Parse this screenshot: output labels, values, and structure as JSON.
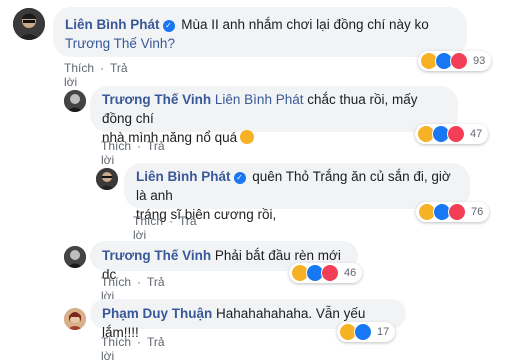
{
  "comments": [
    {
      "author": "Liên Bình Phát",
      "verified": true,
      "text_before": "Mùa II anh nhắm chơi lại đồng chí này ko ",
      "mention": "Trương Thế Vinh?",
      "text_line2": "",
      "like_label": "Thích",
      "reply_label": "Trả lời",
      "reactions": [
        "haha",
        "like",
        "love"
      ],
      "reaction_count": "93"
    },
    {
      "author": "Trương Thế Vinh",
      "verified": false,
      "mention": "Liên Bình Phát",
      "text_after": " chắc thua rồi, mấy đồng chí",
      "text_line2": "nhà mình năng nổ quá",
      "emoji": "sweat-smile-icon",
      "like_label": "Thích",
      "reply_label": "Trả lời",
      "reactions": [
        "haha",
        "like",
        "love"
      ],
      "reaction_count": "47"
    },
    {
      "author": "Liên Bình Phát",
      "verified": true,
      "text_line1": "quên Thỏ Trắng ăn củ sắn đi, giờ là anh",
      "text_line2": "tráng sĩ biên cương rồi,",
      "like_label": "Thích",
      "reply_label": "Trả lời",
      "reactions": [
        "haha",
        "like",
        "love"
      ],
      "reaction_count": "76"
    },
    {
      "author": "Trương Thế Vinh",
      "verified": false,
      "text_line1": "Phải bắt đầu rèn mới dc",
      "like_label": "Thích",
      "reply_label": "Trả lời",
      "reactions": [
        "haha",
        "like",
        "love"
      ],
      "reaction_count": "46"
    },
    {
      "author": "Phạm Duy Thuận",
      "verified": false,
      "text_line1": "Hahahahahaha. Vẫn yếu lắm!!!!",
      "like_label": "Thích",
      "reply_label": "Trả lời",
      "reactions": [
        "haha",
        "like"
      ],
      "reaction_count": "17"
    }
  ],
  "colors": {
    "author": "#385898",
    "bubble": "#f2f3f5",
    "haha": "#f7b125",
    "like": "#1877f2",
    "love": "#f33e58"
  }
}
